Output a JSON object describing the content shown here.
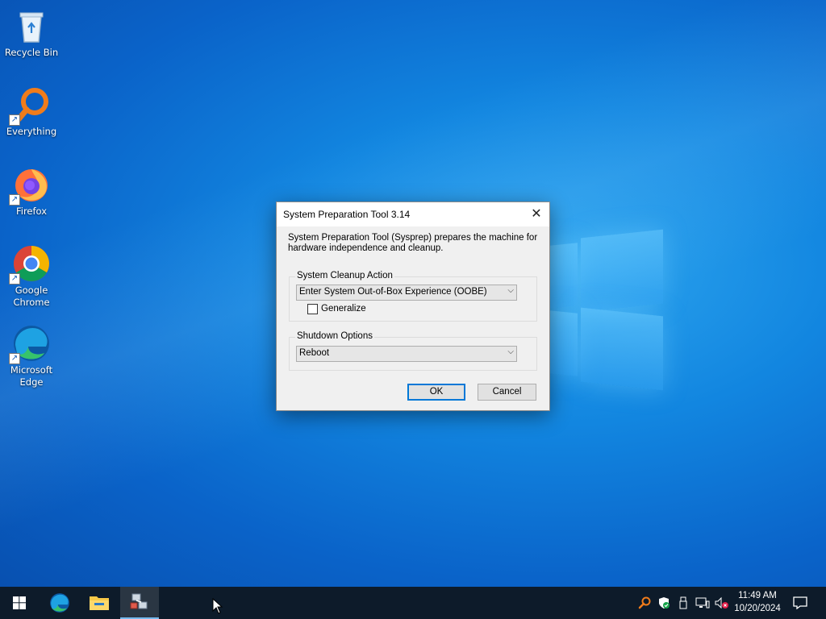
{
  "desktop": {
    "icons": [
      {
        "label": "Recycle Bin",
        "icon": "recycle-bin-icon"
      },
      {
        "label": "Everything",
        "icon": "everything-search-icon"
      },
      {
        "label": "Firefox",
        "icon": "firefox-icon"
      },
      {
        "label": "Google Chrome",
        "icon": "chrome-icon"
      },
      {
        "label": "Microsoft Edge",
        "icon": "edge-icon"
      }
    ]
  },
  "dialog": {
    "title": "System Preparation Tool 3.14",
    "close_glyph": "✕",
    "description": "System Preparation Tool (Sysprep) prepares the machine for hardware independence and cleanup.",
    "cleanup_group_label": "System Cleanup Action",
    "cleanup_action_value": "Enter System Out-of-Box Experience (OOBE)",
    "generalize_label": "Generalize",
    "generalize_checked": false,
    "shutdown_group_label": "Shutdown Options",
    "shutdown_value": "Reboot",
    "ok_label": "OK",
    "cancel_label": "Cancel"
  },
  "taskbar": {
    "pinned": [
      "start-icon",
      "edge-icon",
      "file-explorer-icon",
      "sysprep-icon"
    ],
    "active": "sysprep-icon",
    "time": "11:49 AM",
    "date": "10/20/2024",
    "tray_icons": [
      "everything-tray-icon",
      "security-icon",
      "usb-icon",
      "network-icon",
      "volume-muted-icon",
      "notifications-icon"
    ]
  },
  "colors": {
    "accent": "#0078d7",
    "taskbar": "#0d1b2a"
  }
}
